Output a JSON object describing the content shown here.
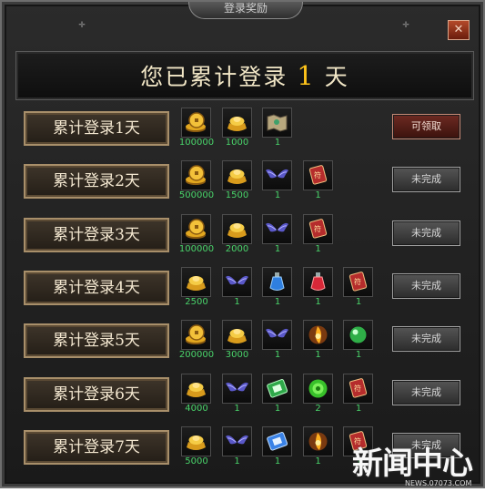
{
  "window": {
    "title": "登录奖励",
    "close_glyph": "✕"
  },
  "header": {
    "prefix": "您已累计登录",
    "count": "1",
    "suffix": "天"
  },
  "rows": [
    {
      "label": "累计登录1天",
      "status": "可领取",
      "status_type": "claim",
      "items": [
        {
          "icon": "gold-coin-icon",
          "qty": "100000"
        },
        {
          "icon": "gold-ingot-icon",
          "qty": "1000"
        },
        {
          "icon": "treasure-map-icon",
          "qty": "1"
        }
      ]
    },
    {
      "label": "累计登录2天",
      "status": "未完成",
      "status_type": "incomplete",
      "items": [
        {
          "icon": "gold-coin-icon",
          "qty": "500000"
        },
        {
          "icon": "gold-ingot-icon",
          "qty": "1500"
        },
        {
          "icon": "wings-icon",
          "qty": "1"
        },
        {
          "icon": "red-scroll-icon",
          "qty": "1"
        }
      ]
    },
    {
      "label": "累计登录3天",
      "status": "未完成",
      "status_type": "incomplete",
      "items": [
        {
          "icon": "gold-coin-icon",
          "qty": "100000"
        },
        {
          "icon": "gold-ingot-icon",
          "qty": "2000"
        },
        {
          "icon": "wings-icon",
          "qty": "1"
        },
        {
          "icon": "red-scroll-icon",
          "qty": "1"
        }
      ]
    },
    {
      "label": "累计登录4天",
      "status": "未完成",
      "status_type": "incomplete",
      "items": [
        {
          "icon": "gold-ingot-icon",
          "qty": "2500"
        },
        {
          "icon": "wings-icon",
          "qty": "1"
        },
        {
          "icon": "blue-potion-icon",
          "qty": "1"
        },
        {
          "icon": "red-potion-icon",
          "qty": "1"
        },
        {
          "icon": "red-scroll-icon",
          "qty": "1"
        }
      ]
    },
    {
      "label": "累计登录5天",
      "status": "未完成",
      "status_type": "incomplete",
      "items": [
        {
          "icon": "gold-coin-icon",
          "qty": "200000"
        },
        {
          "icon": "gold-ingot-icon",
          "qty": "3000"
        },
        {
          "icon": "wings-icon",
          "qty": "1"
        },
        {
          "icon": "fire-rune-icon",
          "qty": "1"
        },
        {
          "icon": "green-orb-icon",
          "qty": "1"
        }
      ]
    },
    {
      "label": "累计登录6天",
      "status": "未完成",
      "status_type": "incomplete",
      "items": [
        {
          "icon": "gold-ingot-icon",
          "qty": "4000"
        },
        {
          "icon": "wings-icon",
          "qty": "1"
        },
        {
          "icon": "green-ticket-icon",
          "qty": "1"
        },
        {
          "icon": "green-gem-icon",
          "qty": "2"
        },
        {
          "icon": "red-scroll-icon",
          "qty": "1"
        }
      ]
    },
    {
      "label": "累计登录7天",
      "status": "未完成",
      "status_type": "incomplete",
      "items": [
        {
          "icon": "gold-ingot-icon",
          "qty": "5000"
        },
        {
          "icon": "wings-icon",
          "qty": "1"
        },
        {
          "icon": "blue-ticket-icon",
          "qty": "1"
        },
        {
          "icon": "fire-rune-icon",
          "qty": "1"
        },
        {
          "icon": "red-scroll-icon",
          "qty": "1"
        }
      ]
    }
  ],
  "watermark": {
    "big": "新闻中心",
    "small": "NEWS.07073.COM"
  },
  "colors": {
    "header_count": "#ffc41a",
    "quantity": "#49d36a",
    "claim_button": "#6e2a22"
  }
}
